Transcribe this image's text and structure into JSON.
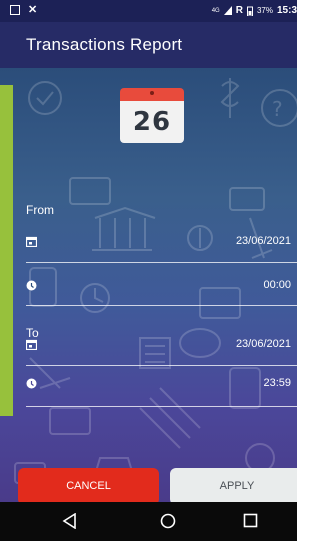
{
  "status_bar": {
    "left_icons": [
      "notification-icon",
      "close-icon"
    ],
    "network": "4G",
    "carrier_letter": "R",
    "battery": "37%",
    "time": "15:3"
  },
  "app_bar": {
    "title": "Transactions Report"
  },
  "calendar": {
    "day": "26"
  },
  "from": {
    "label": "From",
    "date": "23/06/2021",
    "time": "00:00"
  },
  "to": {
    "label": "To",
    "date": "23/06/2021",
    "time": "23:59"
  },
  "buttons": {
    "cancel": "CANCEL",
    "apply": "APPLY"
  },
  "navbar": {
    "icons": [
      "back-icon",
      "home-icon",
      "recents-icon"
    ]
  },
  "colors": {
    "status_bar": "#1c2156",
    "app_bar": "#262b66",
    "accent": "#97c13c",
    "cancel": "#e22b1c",
    "apply": "#e9ecec",
    "calendar_top": "#e84b3c"
  }
}
